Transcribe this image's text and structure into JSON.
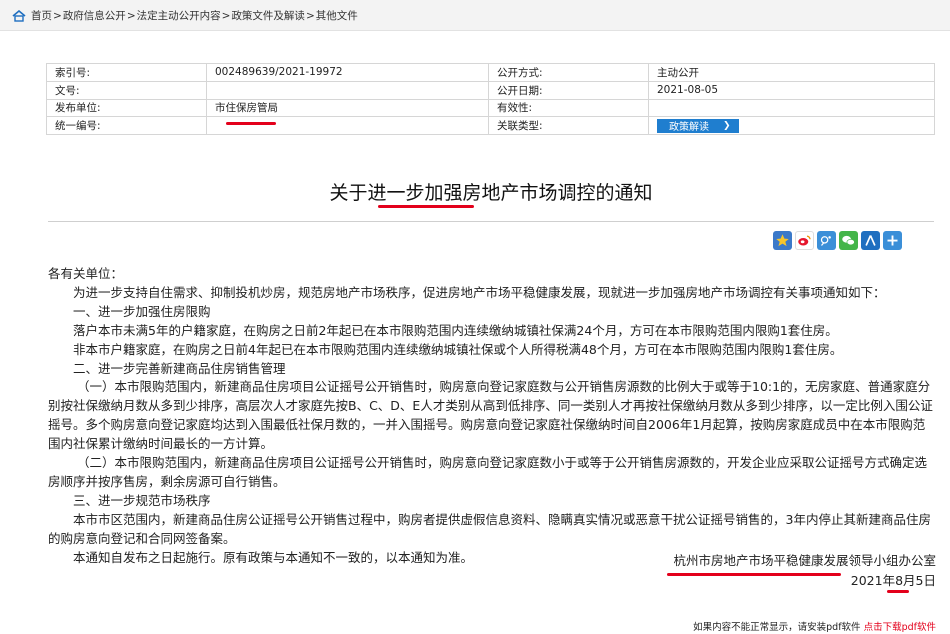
{
  "breadcrumb": {
    "items": [
      "首页",
      "政府信息公开",
      "法定主动公开内容",
      "政策文件及解读",
      "其他文件"
    ],
    "separator": ">"
  },
  "meta": {
    "rows": [
      {
        "label1": "索引号:",
        "value1": "002489639/2021-19972",
        "label2": "公开方式:",
        "value2": "主动公开"
      },
      {
        "label1": "文号:",
        "value1": "",
        "label2": "公开日期:",
        "value2": "2021-08-05"
      },
      {
        "label1": "发布单位:",
        "value1": "市住保房管局",
        "label2": "有效性:",
        "value2": ""
      },
      {
        "label1": "统一编号:",
        "value1": "",
        "label2": "关联类型:",
        "value2": ""
      }
    ],
    "policy_button": "政策解读"
  },
  "document": {
    "title": "关于进一步加强房地产市场调控的通知",
    "paragraphs": [
      "各有关单位：",
      "为进一步支持自住需求、抑制投机炒房，规范房地产市场秩序，促进房地产市场平稳健康发展，现就进一步加强房地产市场调控有关事项通知如下：",
      "一、进一步加强住房限购",
      "落户本市未满5年的户籍家庭，在购房之日前2年起已在本市限购范围内连续缴纳城镇社保满24个月，方可在本市限购范围内限购1套住房。",
      "非本市户籍家庭，在购房之日前4年起已在本市限购范围内连续缴纳城镇社保或个人所得税满48个月，方可在本市限购范围内限购1套住房。",
      "二、进一步完善新建商品住房销售管理",
      "（一）本市限购范围内，新建商品住房项目公证摇号公开销售时，购房意向登记家庭数与公开销售房源数的比例大于或等于10:1的，无房家庭、普通家庭分别按社保缴纳月数从多到少排序，高层次人才家庭先按B、C、D、E人才类别从高到低排序、同一类别人才再按社保缴纳月数从多到少排序，以一定比例入围公证摇号。多个购房意向登记家庭均达到入围最低社保月数的，一并入围摇号。购房意向登记家庭社保缴纳时间自2006年1月起算，按购房家庭成员中在本市限购范围内社保累计缴纳时间最长的一方计算。",
      "（二）本市限购范围内，新建商品住房项目公证摇号公开销售时，购房意向登记家庭数小于或等于公开销售房源数的，开发企业应采取公证摇号方式确定选房顺序并按序售房，剩余房源可自行销售。",
      "三、进一步规范市场秩序",
      "本市市区范围内，新建商品住房公证摇号公开销售过程中，购房者提供虚假信息资料、隐瞒真实情况或恶意干扰公证摇号销售的，3年内停止其新建商品住房的购房意向登记和合同网签备案。",
      "本通知自发布之日起施行。原有政策与本通知不一致的，以本通知为准。"
    ],
    "signature": "杭州市房地产市场平稳健康发展领导小组办公室",
    "date": "2021年8月5日"
  },
  "share_icons": [
    "qzone-star-icon",
    "weibo-icon",
    "tencent-weibo-icon",
    "wechat-icon",
    "renren-icon",
    "more-share-icon"
  ],
  "footer": {
    "notice": "如果内容不能正常显示，请安装pdf软件",
    "download_link": "点击下载pdf软件"
  },
  "colors": {
    "accent": "#1f7ecf",
    "annotation_red": "#e3001b"
  }
}
